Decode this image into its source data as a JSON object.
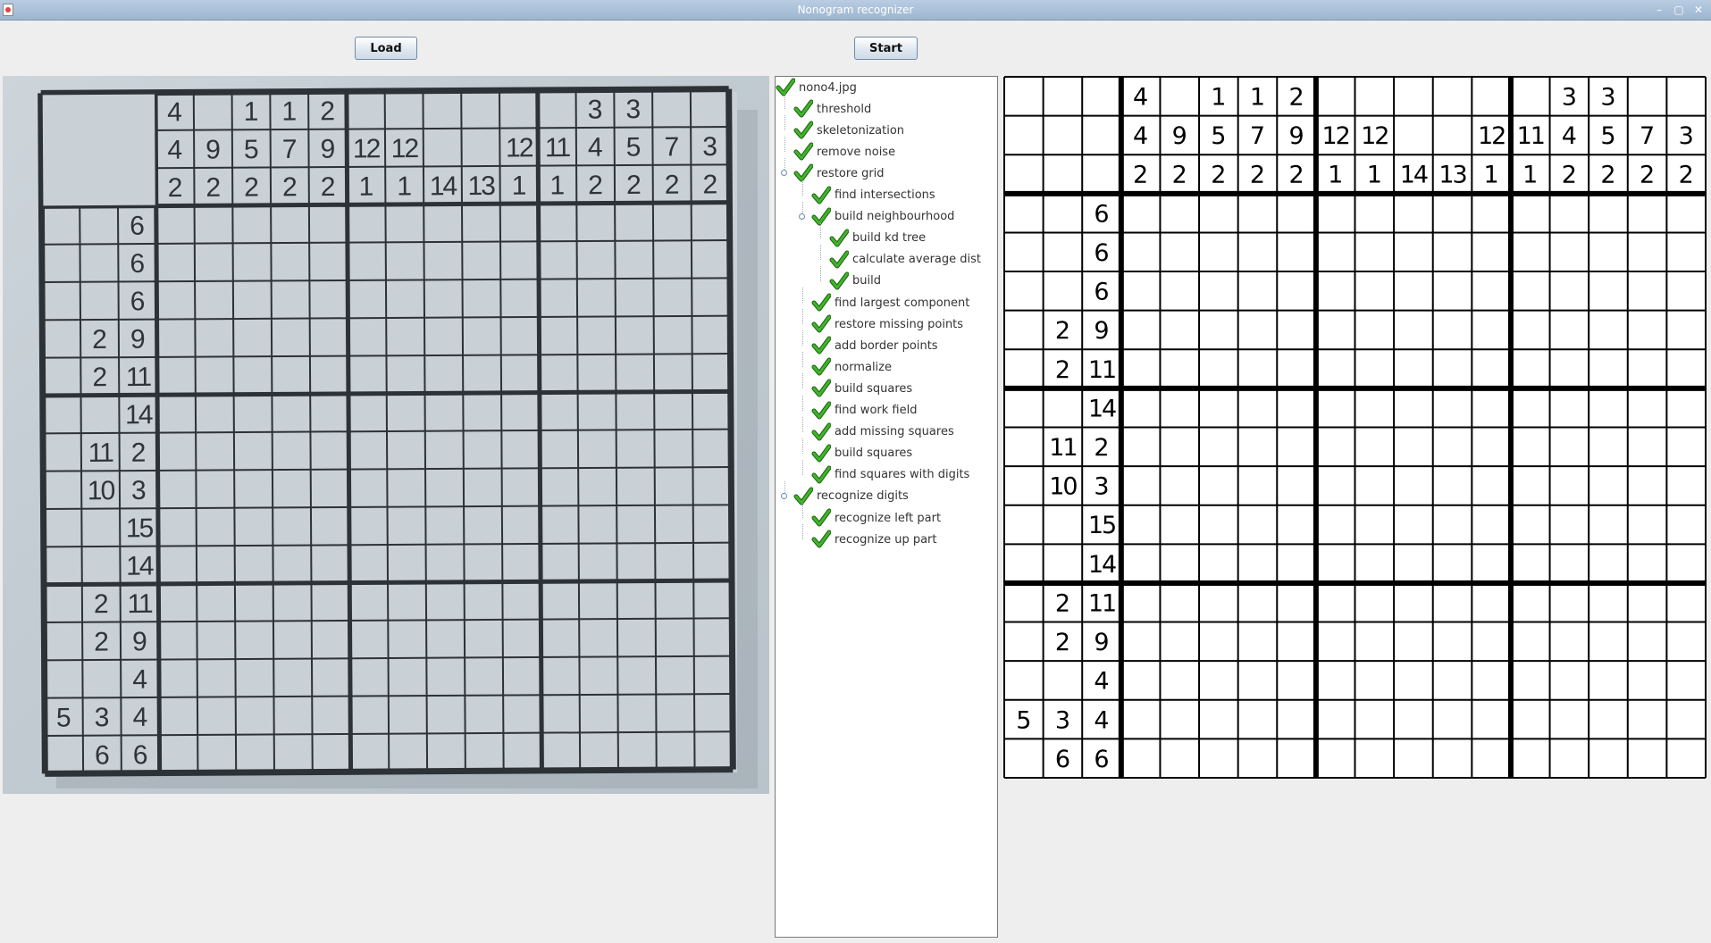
{
  "window": {
    "title": "Nonogram recognizer",
    "controls": {
      "minimize": "–",
      "maximize": "▢",
      "close": "✕"
    }
  },
  "toolbar": {
    "load_label": "Load",
    "start_label": "Start"
  },
  "tree": {
    "items": [
      {
        "label": "nono4.jpg",
        "level": 0,
        "expandable": false,
        "checked": true
      },
      {
        "label": "threshold",
        "level": 1,
        "checked": true
      },
      {
        "label": "skeletonization",
        "level": 1,
        "checked": true
      },
      {
        "label": "remove noise",
        "level": 1,
        "checked": true
      },
      {
        "label": "restore grid",
        "level": 1,
        "expandable": true,
        "checked": true
      },
      {
        "label": "find intersections",
        "level": 2,
        "checked": true
      },
      {
        "label": "build neighbourhood",
        "level": 2,
        "expandable": true,
        "checked": true
      },
      {
        "label": "build kd tree",
        "level": 3,
        "checked": true
      },
      {
        "label": "calculate average dist",
        "level": 3,
        "checked": true
      },
      {
        "label": "build",
        "level": 3,
        "checked": true
      },
      {
        "label": "find largest component",
        "level": 2,
        "checked": true
      },
      {
        "label": "restore missing points",
        "level": 2,
        "checked": true
      },
      {
        "label": "add border points",
        "level": 2,
        "checked": true
      },
      {
        "label": "normalize",
        "level": 2,
        "checked": true
      },
      {
        "label": "build squares",
        "level": 2,
        "checked": true
      },
      {
        "label": "find work field",
        "level": 2,
        "checked": true
      },
      {
        "label": "add missing squares",
        "level": 2,
        "checked": true
      },
      {
        "label": "build squares",
        "level": 2,
        "checked": true
      },
      {
        "label": "find squares with digits",
        "level": 2,
        "checked": true
      },
      {
        "label": "recognize digits",
        "level": 1,
        "expandable": true,
        "checked": true
      },
      {
        "label": "recognize left part",
        "level": 2,
        "checked": true
      },
      {
        "label": "recognize up part",
        "level": 2,
        "checked": true
      }
    ]
  },
  "nonogram": {
    "columns": 15,
    "rows": 15,
    "column_clues": [
      [
        "4",
        "4",
        "2"
      ],
      [
        "",
        "9",
        "2"
      ],
      [
        "1",
        "5",
        "2"
      ],
      [
        "1",
        "7",
        "2"
      ],
      [
        "2",
        "9",
        "2"
      ],
      [
        "",
        "12",
        "1"
      ],
      [
        "",
        "12",
        "1"
      ],
      [
        "",
        "",
        "14"
      ],
      [
        "",
        "",
        "13"
      ],
      [
        "",
        "12",
        "1"
      ],
      [
        "",
        "11",
        "1"
      ],
      [
        "3",
        "4",
        "2"
      ],
      [
        "3",
        "5",
        "2"
      ],
      [
        "",
        "7",
        "2"
      ],
      [
        "",
        "3",
        "2"
      ]
    ],
    "row_clues": [
      [
        "",
        "",
        "6"
      ],
      [
        "",
        "",
        "6"
      ],
      [
        "",
        "",
        "6"
      ],
      [
        "",
        "2",
        "9"
      ],
      [
        "",
        "2",
        "11"
      ],
      [
        "",
        "",
        "14"
      ],
      [
        "",
        "11",
        "2"
      ],
      [
        "",
        "10",
        "3"
      ],
      [
        "",
        "",
        "15"
      ],
      [
        "",
        "",
        "14"
      ],
      [
        "",
        "2",
        "11"
      ],
      [
        "",
        "2",
        "9"
      ],
      [
        "",
        "",
        "4"
      ],
      [
        "5",
        "3",
        "4"
      ],
      [
        "",
        "6",
        "6"
      ]
    ]
  },
  "colors": {
    "check_green": "#3fb52a",
    "grid_line": "#000000",
    "photo_ink": "#2c3236",
    "tree_text": "#333333"
  }
}
